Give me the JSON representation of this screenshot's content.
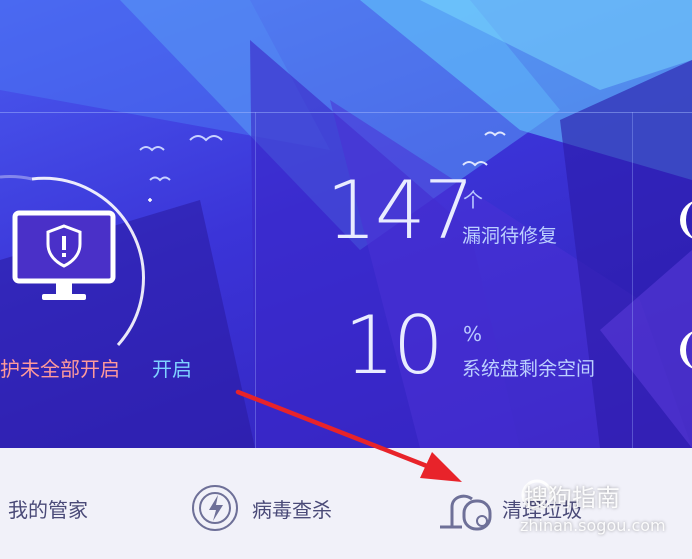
{
  "stats": {
    "vulnerabilities": {
      "value": "147",
      "unit": "个",
      "label": "漏洞待修复"
    },
    "disk_space": {
      "value": "10",
      "unit": "%",
      "label": "系统盘剩余空间"
    }
  },
  "protection": {
    "status_text": "护未全部开启",
    "action_label": "开启"
  },
  "toolbar": {
    "items": [
      {
        "label": "我的管家",
        "icon": "manager-icon"
      },
      {
        "label": "病毒查杀",
        "icon": "virus-scan-icon"
      },
      {
        "label": "清理垃圾",
        "icon": "vacuum-cleaner-icon"
      }
    ]
  },
  "watermark": {
    "brand": "搜狗指南",
    "url": "zhinan.sogou.com"
  },
  "colors": {
    "hero_bg": "#3b34d8",
    "alert_text": "#ff9a9a",
    "link": "#7fd1ff",
    "annotation_arrow": "#e8232a"
  }
}
